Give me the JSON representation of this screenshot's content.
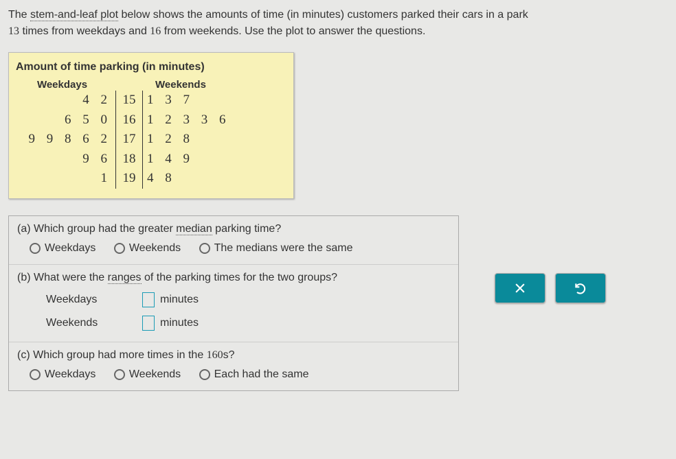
{
  "intro": {
    "t1": "The ",
    "t_link1": "stem-and-leaf plot",
    "t2": " below shows the amounts of time (in minutes) customers parked their cars in a park",
    "n1": "13",
    "t3": " times from weekdays and ",
    "n2": "16",
    "t4": " from weekends. Use the plot to answer the questions."
  },
  "plot": {
    "title": "Amount of time parking (in minutes)",
    "left_header": "Weekdays",
    "right_header": "Weekends",
    "rows": [
      {
        "left": "4 2",
        "stem": "15",
        "right": "1 3 7"
      },
      {
        "left": "6 5 0",
        "stem": "16",
        "right": "1 2 3 3 6"
      },
      {
        "left": "9 9 8 6 2",
        "stem": "17",
        "right": "1 2 8"
      },
      {
        "left": "9 6",
        "stem": "18",
        "right": "1 4 9"
      },
      {
        "left": "1",
        "stem": "19",
        "right": "4 8"
      }
    ]
  },
  "q": {
    "a": {
      "prompt_pre": "(a) Which group had the greater ",
      "prompt_link": "median",
      "prompt_post": " parking time?",
      "opts": [
        "Weekdays",
        "Weekends",
        "The medians were the same"
      ]
    },
    "b": {
      "prompt_pre": "(b) What were the ",
      "prompt_link": "ranges",
      "prompt_post": " of the parking times for the two groups?",
      "rows": [
        {
          "label": "Weekdays",
          "unit": "minutes"
        },
        {
          "label": "Weekends",
          "unit": "minutes"
        }
      ]
    },
    "c": {
      "prompt_pre": "(c) Which group had more times in the ",
      "prompt_num": "160",
      "prompt_post": "s?",
      "opts": [
        "Weekdays",
        "Weekends",
        "Each had the same"
      ]
    }
  },
  "chart_data": {
    "type": "table",
    "title": "Amount of time parking (in minutes)",
    "description": "Back-to-back stem-and-leaf plot",
    "stems": [
      15,
      16,
      17,
      18,
      19
    ],
    "series": [
      {
        "name": "Weekdays",
        "values": [
          152,
          154,
          160,
          165,
          166,
          172,
          176,
          178,
          179,
          179,
          186,
          189,
          191
        ]
      },
      {
        "name": "Weekends",
        "values": [
          151,
          153,
          157,
          161,
          162,
          163,
          163,
          166,
          171,
          172,
          178,
          181,
          184,
          189,
          194,
          198
        ]
      }
    ]
  }
}
